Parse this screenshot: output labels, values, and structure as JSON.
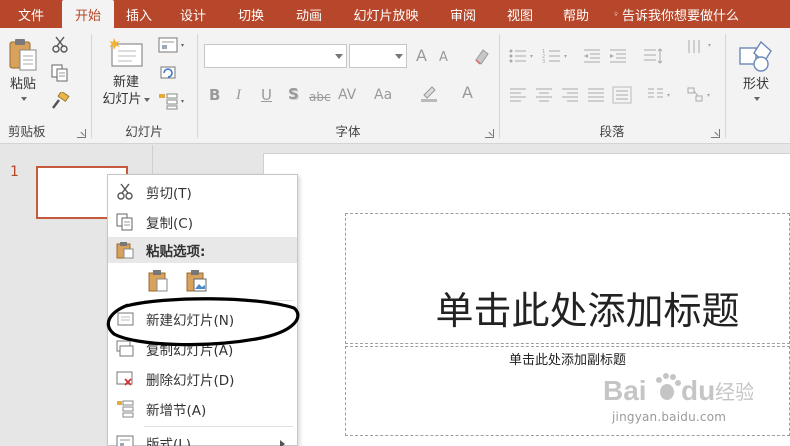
{
  "tabs": {
    "file": "文件",
    "home": "开始",
    "insert": "插入",
    "design": "设计",
    "transitions": "切换",
    "animations": "动画",
    "slideshow": "幻灯片放映",
    "review": "审阅",
    "view": "视图",
    "help": "帮助",
    "tell_me": "告诉我你想要做什么"
  },
  "ribbon": {
    "clipboard": {
      "paste_label": "粘贴",
      "group_label": "剪贴板"
    },
    "slides": {
      "new_slide_line1": "新建",
      "new_slide_line2": "幻灯片",
      "group_label": "幻灯片"
    },
    "font": {
      "group_label": "字体",
      "font_name": "",
      "font_size": "",
      "bold": "B",
      "italic": "I",
      "underline": "U",
      "shadow": "S",
      "strike": "abc",
      "spacing": "AV",
      "case": "Aa",
      "grow": "A",
      "shrink": "A",
      "color": "A"
    },
    "paragraph": {
      "group_label": "段落"
    },
    "drawing": {
      "shapes_label": "形状"
    }
  },
  "thumbnail": {
    "slide_number": "1"
  },
  "slide": {
    "title_placeholder": "单击此处添加标题",
    "subtitle_placeholder": "单击此处添加副标题"
  },
  "context_menu": {
    "cut": "剪切(T)",
    "copy": "复制(C)",
    "paste_options": "粘贴选项:",
    "new_slide": "新建幻灯片(N)",
    "duplicate_slide": "复制幻灯片(A)",
    "delete_slide": "删除幻灯片(D)",
    "new_section": "新增节(A)",
    "layout": "版式(L)"
  },
  "watermark": {
    "brand": "Bai",
    "brand2": "du",
    "product": "经验",
    "url": "jingyan.baidu.com"
  },
  "colors": {
    "accent": "#b7472a",
    "ribbon_bg": "#f3f3f3",
    "pane_bg": "#e6e6e6"
  }
}
